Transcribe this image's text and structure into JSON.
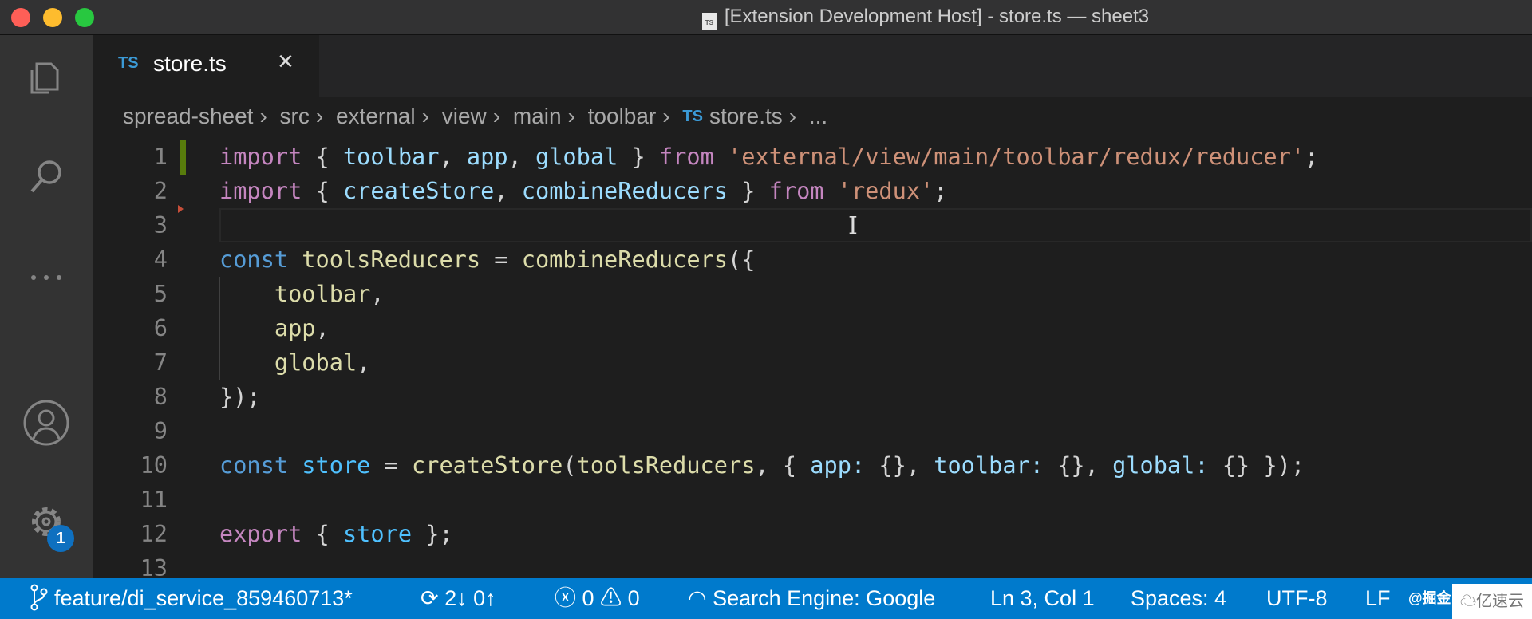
{
  "window": {
    "title": "[Extension Development Host] - store.ts — sheet3",
    "file_badge": "TS"
  },
  "activity_bar": {
    "items": [
      "explorer-icon",
      "search-icon",
      "more-icon",
      "account-icon",
      "settings-icon"
    ],
    "settings_badge": "1"
  },
  "tab": {
    "lang": "TS",
    "label": "store.ts",
    "close": "×"
  },
  "breadcrumb": {
    "items": [
      "spread-sheet",
      "src",
      "external",
      "view",
      "main",
      "toolbar"
    ],
    "file_lang": "TS",
    "file": "store.ts",
    "more": "...",
    "separator": "›"
  },
  "editor": {
    "lines": [
      {
        "n": "1",
        "t": [
          [
            "kw",
            "import"
          ],
          [
            "p",
            " { "
          ],
          [
            "v",
            "toolbar"
          ],
          [
            "p",
            ", "
          ],
          [
            "v",
            "app"
          ],
          [
            "p",
            ", "
          ],
          [
            "v",
            "global"
          ],
          [
            "p",
            " } "
          ],
          [
            "kw",
            "from"
          ],
          [
            "p",
            " "
          ],
          [
            "s",
            "'external/view/main/toolbar/redux/reducer'"
          ],
          [
            "p",
            ";"
          ]
        ]
      },
      {
        "n": "2",
        "t": [
          [
            "kw",
            "import"
          ],
          [
            "p",
            " { "
          ],
          [
            "v",
            "createStore"
          ],
          [
            "p",
            ", "
          ],
          [
            "v",
            "combineReducers"
          ],
          [
            "p",
            " } "
          ],
          [
            "kw",
            "from"
          ],
          [
            "p",
            " "
          ],
          [
            "s",
            "'redux'"
          ],
          [
            "p",
            ";"
          ]
        ]
      },
      {
        "n": "3",
        "t": []
      },
      {
        "n": "4",
        "t": [
          [
            "st",
            "const"
          ],
          [
            "p",
            " "
          ],
          [
            "f",
            "toolsReducers"
          ],
          [
            "p",
            " = "
          ],
          [
            "f",
            "combineReducers"
          ],
          [
            "p",
            "({"
          ]
        ]
      },
      {
        "n": "5",
        "t": [
          [
            "p",
            "    "
          ],
          [
            "f",
            "toolbar"
          ],
          [
            "p",
            ","
          ]
        ]
      },
      {
        "n": "6",
        "t": [
          [
            "p",
            "    "
          ],
          [
            "f",
            "app"
          ],
          [
            "p",
            ","
          ]
        ]
      },
      {
        "n": "7",
        "t": [
          [
            "p",
            "    "
          ],
          [
            "f",
            "global"
          ],
          [
            "p",
            ","
          ]
        ]
      },
      {
        "n": "8",
        "t": [
          [
            "p",
            "});"
          ]
        ]
      },
      {
        "n": "9",
        "t": []
      },
      {
        "n": "10",
        "t": [
          [
            "st",
            "const"
          ],
          [
            "p",
            " "
          ],
          [
            "c",
            "store"
          ],
          [
            "p",
            " = "
          ],
          [
            "f",
            "createStore"
          ],
          [
            "p",
            "("
          ],
          [
            "f",
            "toolsReducers"
          ],
          [
            "p",
            ", { "
          ],
          [
            "v",
            "app:"
          ],
          [
            "p",
            " {}, "
          ],
          [
            "v",
            "toolbar:"
          ],
          [
            "p",
            " {}, "
          ],
          [
            "v",
            "global:"
          ],
          [
            "p",
            " {} });"
          ]
        ]
      },
      {
        "n": "11",
        "t": []
      },
      {
        "n": "12",
        "t": [
          [
            "kw",
            "export"
          ],
          [
            "p",
            " { "
          ],
          [
            "c",
            "store"
          ],
          [
            "p",
            " };"
          ]
        ]
      },
      {
        "n": "13",
        "t": []
      }
    ],
    "current_line": 3
  },
  "status_bar": {
    "branch": "feature/di_service_859460713*",
    "sync": "2↓ 0↑",
    "errors": "0",
    "warnings": "0",
    "search_engine": "Search Engine: Google",
    "position": "Ln 3, Col 1",
    "spaces": "Spaces: 4",
    "encoding": "UTF-8",
    "eol": "LF",
    "color": "#007acc"
  },
  "watermark": {
    "left": "@掘金",
    "right": "亿速云"
  }
}
